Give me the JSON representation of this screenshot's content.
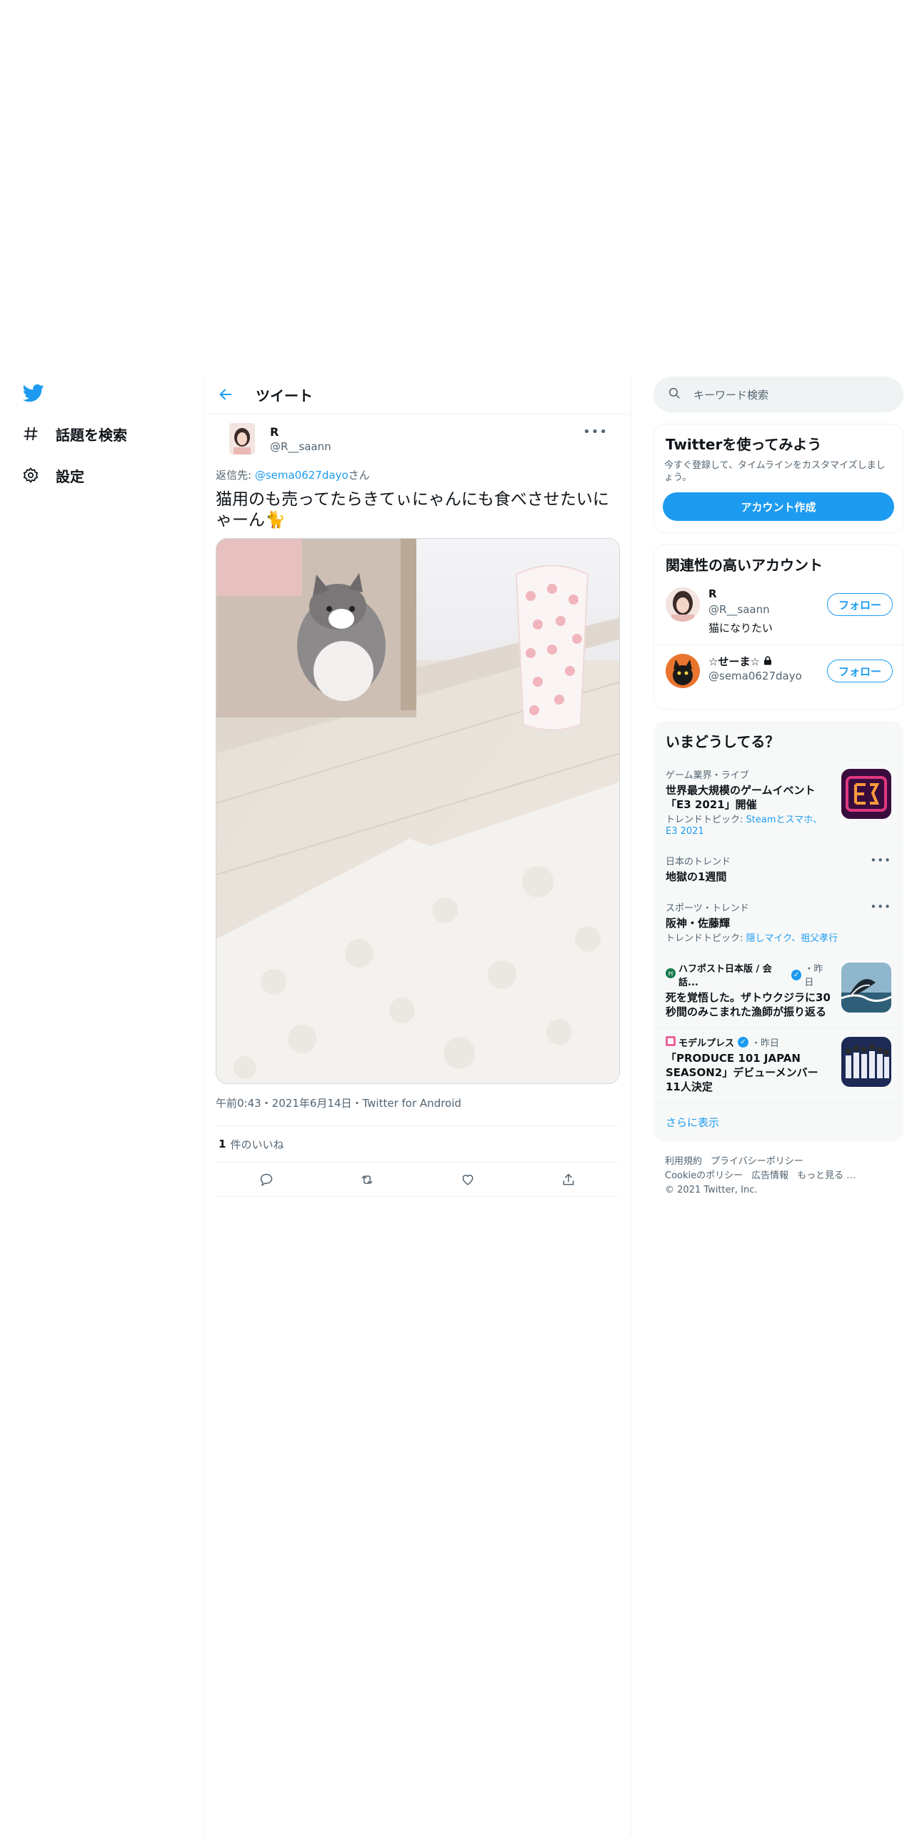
{
  "nav": {
    "items": [
      {
        "label": "話題を検索",
        "icon": "hashtag-icon"
      },
      {
        "label": "設定",
        "icon": "gear-icon"
      }
    ]
  },
  "header": {
    "title": "ツイート"
  },
  "tweet": {
    "name": "R",
    "handle": "@R__saann",
    "reply_prefix": "返信先: ",
    "reply_to": "@sema0627dayo",
    "reply_suffix": "さん",
    "text": "猫用のも売ってたらきてぃにゃんにも食べさせたいにゃーん🐈",
    "meta": "午前0:43・2021年6月14日・Twitter for Android",
    "likes_count": "1",
    "likes_label": "件のいいね"
  },
  "search": {
    "placeholder": "キーワード検索"
  },
  "signup": {
    "title": "Twitterを使ってみよう",
    "text": "今すぐ登録して、タイムラインをカスタマイズしましょう。",
    "button": "アカウント作成"
  },
  "related": {
    "title": "関連性の高いアカウント",
    "accounts": [
      {
        "name": "R",
        "handle": "@R__saann",
        "bio": "猫になりたい",
        "follow": "フォロー"
      },
      {
        "name": "☆せーま☆",
        "handle": "@sema0627dayo",
        "bio": "",
        "follow": "フォロー"
      }
    ]
  },
  "trends": {
    "title": "いまどうしてる？",
    "items": [
      {
        "meta": "ゲーム業界・ライブ",
        "title": "世界最大規模のゲームイベント「E3 2021」開催",
        "sub_prefix": "トレンドトピック: ",
        "sub_link": "Steamとスマホ、E3 2021"
      },
      {
        "meta": "日本のトレンド",
        "title": "地獄の1週間"
      },
      {
        "meta": "スポーツ・トレンド",
        "title": "阪神・佐藤輝",
        "sub_prefix": "トレンドトピック: ",
        "sub_link": "隠しマイク、祖父孝行"
      },
      {
        "source": "ハフポスト日本版 / 会話...",
        "when": "・昨日",
        "title": "死を覚悟した。ザトウクジラに30秒間のみこまれた漁師が振り返る"
      },
      {
        "source": "モデルプレス",
        "when": "・昨日",
        "title": "「PRODUCE 101 JAPAN SEASON2」デビューメンバー11人決定"
      }
    ],
    "show_more": "さらに表示"
  },
  "footer": {
    "links": [
      "利用規約",
      "プライバシーポリシー",
      "Cookieのポリシー",
      "広告情報",
      "もっと見る …"
    ],
    "copyright": "© 2021 Twitter, Inc."
  },
  "colors": {
    "accent": "#1d9bf0",
    "text": "#0f1419",
    "muted": "#536471"
  }
}
